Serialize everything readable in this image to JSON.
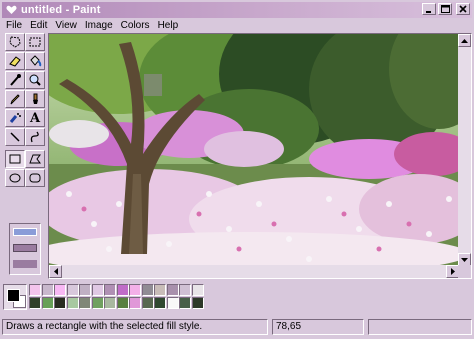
{
  "window": {
    "title": "untitled - Paint",
    "app_icon": "heart-icon"
  },
  "menu": [
    "File",
    "Edit",
    "View",
    "Image",
    "Colors",
    "Help"
  ],
  "tools": [
    {
      "name": "free-form-select-icon"
    },
    {
      "name": "rect-select-icon"
    },
    {
      "name": "eraser-icon"
    },
    {
      "name": "fill-bucket-icon"
    },
    {
      "name": "pick-color-icon"
    },
    {
      "name": "magnifier-icon"
    },
    {
      "name": "pencil-icon"
    },
    {
      "name": "brush-icon"
    },
    {
      "name": "airbrush-icon"
    },
    {
      "name": "text-icon",
      "glyph": "A"
    },
    {
      "name": "line-icon"
    },
    {
      "name": "curve-icon"
    },
    {
      "name": "rectangle-icon",
      "active": true
    },
    {
      "name": "polygon-icon"
    },
    {
      "name": "ellipse-icon"
    },
    {
      "name": "rounded-rectangle-icon"
    }
  ],
  "fill_styles": [
    "outline",
    "outline-fill",
    "fill"
  ],
  "palette": {
    "foreground": "#000000",
    "background": "#ffffff",
    "colors_row1": [
      "#f4c4ec",
      "#c8b8cc",
      "#f8b8f4",
      "#d8c8dc",
      "#c0b0c4",
      "#e0c8e4",
      "#b090b4",
      "#c06cc8",
      "#f4b0e8",
      "#908c94",
      "#c8bcb8",
      "#a890ac",
      "#d0c0d4",
      "#e8e4e8"
    ],
    "colors_row2": [
      "#304028",
      "#68a058",
      "#282c20",
      "#a8c8a0",
      "#808878",
      "#70a060",
      "#a8b8a0",
      "#588040",
      "#e098d8",
      "#586850",
      "#304830",
      "#f8f8f8",
      "#486048",
      "#2c3828"
    ]
  },
  "status": {
    "help_text": "Draws a rectangle with the selected fill style.",
    "coordinates": "78,65"
  }
}
